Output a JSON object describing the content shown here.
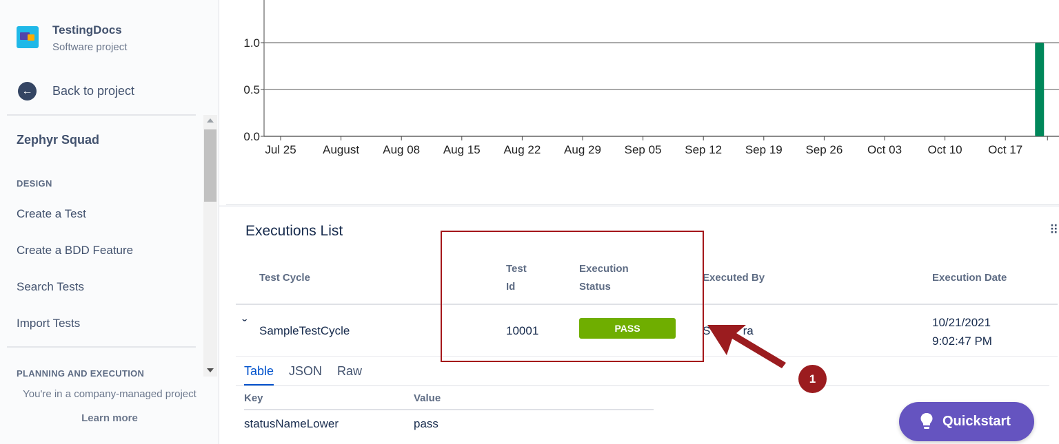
{
  "sidebar": {
    "project_name": "TestingDocs",
    "project_type": "Software project",
    "back_label": "Back to project",
    "app_title": "Zephyr Squad",
    "design_heading": "DESIGN",
    "design_items": [
      "Create a Test",
      "Create a BDD Feature",
      "Search Tests",
      "Import Tests"
    ],
    "planning_heading": "PLANNING AND EXECUTION",
    "managed_text": "You're in a company-managed project",
    "learn_more": "Learn more"
  },
  "chart_data": {
    "type": "bar",
    "x_tick_labels": [
      "Jul 25",
      "August",
      "Aug 08",
      "Aug 15",
      "Aug 22",
      "Aug 29",
      "Sep 05",
      "Sep 12",
      "Sep 19",
      "Sep 26",
      "Oct 03",
      "Oct 10",
      "Oct 17"
    ],
    "y_tick_labels": [
      "1.0",
      "0.5",
      "0.0"
    ],
    "series": [
      {
        "x": "2021-10-21",
        "values": [
          1.0
        ],
        "color": "#00875a"
      }
    ],
    "ylim": [
      0,
      1.0
    ],
    "grid": true
  },
  "executions": {
    "title": "Executions List",
    "columns": {
      "test_cycle": "Test Cycle",
      "test_id_1": "Test",
      "test_id_2": "Id",
      "status_1": "Execution",
      "status_2": "Status",
      "executed_by": "Executed By",
      "execution_date": "Execution Date"
    },
    "row": {
      "test_cycle": "SampleTestCycle",
      "test_id": "10001",
      "status": "PASS",
      "executed_by": "S          ra",
      "date_line1": "10/21/2021",
      "date_line2": "9:02:47 PM"
    },
    "detail_tabs": [
      "Table",
      "JSON",
      "Raw"
    ],
    "detail": {
      "key_header": "Key",
      "value_header": "Value",
      "key": "statusNameLower",
      "value": "pass"
    }
  },
  "annotation": {
    "badge": "1",
    "color": "#9b1c1f"
  },
  "quickstart": {
    "label": "Quickstart"
  }
}
